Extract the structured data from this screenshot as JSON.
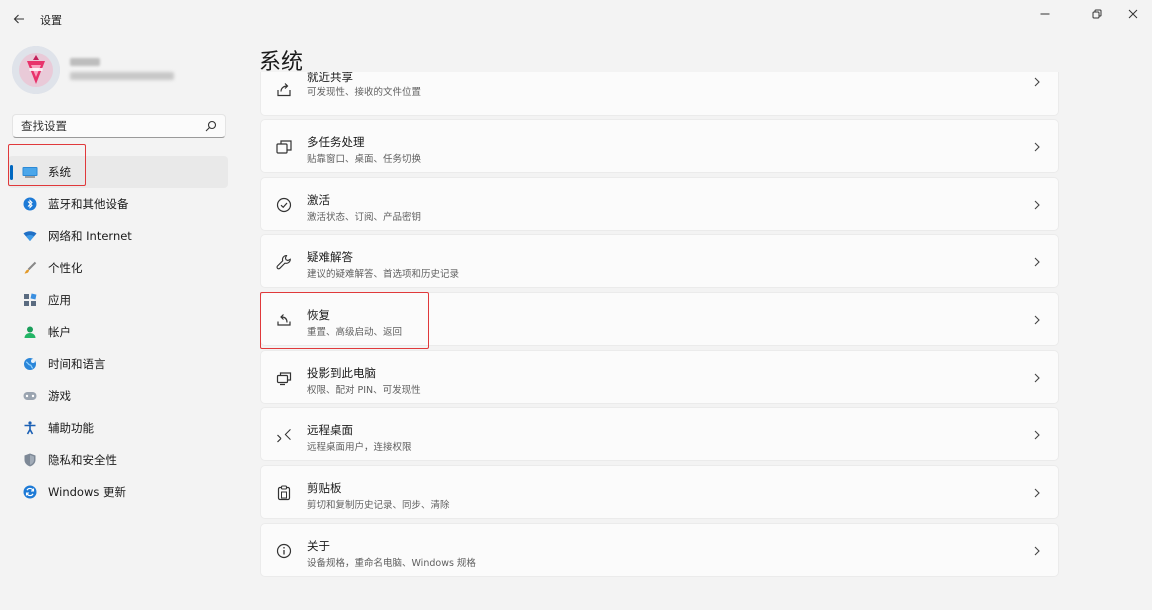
{
  "window": {
    "title": "设置"
  },
  "profile": {},
  "search": {
    "placeholder": "查找设置"
  },
  "sidebar": {
    "items": [
      {
        "label": "系统",
        "icon": "system-icon",
        "active": true
      },
      {
        "label": "蓝牙和其他设备",
        "icon": "bluetooth-icon"
      },
      {
        "label": "网络和 Internet",
        "icon": "wifi-icon"
      },
      {
        "label": "个性化",
        "icon": "brush-icon"
      },
      {
        "label": "应用",
        "icon": "apps-icon"
      },
      {
        "label": "帐户",
        "icon": "account-icon"
      },
      {
        "label": "时间和语言",
        "icon": "clock-globe-icon"
      },
      {
        "label": "游戏",
        "icon": "gamepad-icon"
      },
      {
        "label": "辅助功能",
        "icon": "accessibility-icon"
      },
      {
        "label": "隐私和安全性",
        "icon": "shield-icon"
      },
      {
        "label": "Windows 更新",
        "icon": "update-icon"
      }
    ]
  },
  "main": {
    "title": "系统",
    "cards": [
      {
        "title": "就近共享",
        "desc": "可发现性、接收的文件位置",
        "icon": "share-icon"
      },
      {
        "title": "多任务处理",
        "desc": "贴靠窗口、桌面、任务切换",
        "icon": "multitask-icon"
      },
      {
        "title": "激活",
        "desc": "激活状态、订阅、产品密钥",
        "icon": "check-circle-icon"
      },
      {
        "title": "疑难解答",
        "desc": "建议的疑难解答、首选项和历史记录",
        "icon": "wrench-icon"
      },
      {
        "title": "恢复",
        "desc": "重置、高级启动、返回",
        "icon": "recovery-icon"
      },
      {
        "title": "投影到此电脑",
        "desc": "权限、配对 PIN、可发现性",
        "icon": "project-icon"
      },
      {
        "title": "远程桌面",
        "desc": "远程桌面用户，连接权限",
        "icon": "remote-desktop-icon"
      },
      {
        "title": "剪贴板",
        "desc": "剪切和复制历史记录、同步、清除",
        "icon": "clipboard-icon"
      },
      {
        "title": "关于",
        "desc": "设备规格，重命名电脑、Windows 规格",
        "icon": "info-icon"
      }
    ]
  },
  "colors": {
    "accent": "#0067c0",
    "highlight": "#e0393b",
    "background": "#f3f3f3",
    "card": "#fbfbfb"
  }
}
